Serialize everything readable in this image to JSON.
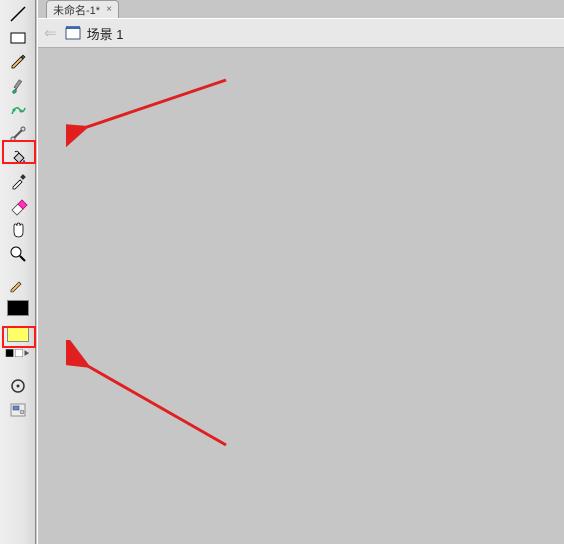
{
  "tab": {
    "label": "未命名-1*",
    "close_glyph": "×"
  },
  "scene": {
    "back_glyph": "⇐",
    "label": "场景 1"
  },
  "tools": [
    {
      "id": "line",
      "name": "line-tool-icon"
    },
    {
      "id": "rectangle",
      "name": "rectangle-tool-icon"
    },
    {
      "id": "pencil",
      "name": "pencil-tool-icon"
    },
    {
      "id": "brush",
      "name": "brush-tool-icon"
    },
    {
      "id": "deco",
      "name": "deco-tool-icon"
    },
    {
      "id": "bone",
      "name": "bone-tool-icon"
    },
    {
      "id": "paintbucket",
      "name": "paint-bucket-tool-icon",
      "highlight": true
    },
    {
      "id": "eyedropper",
      "name": "eyedropper-tool-icon"
    },
    {
      "id": "eraser",
      "name": "eraser-tool-icon"
    },
    {
      "id": "hand",
      "name": "hand-tool-icon"
    },
    {
      "id": "zoom",
      "name": "zoom-tool-icon"
    }
  ],
  "colors": {
    "stroke_swatch": "#000000",
    "fill_swatch": "#ffff66",
    "fill_highlight": true
  },
  "color_mode_icons": [
    "swap-colors-icon",
    "no-color-icon"
  ],
  "below_tools": [
    {
      "id": "snap",
      "name": "snap-tool-icon"
    },
    {
      "id": "options",
      "name": "options-tool-icon"
    }
  ],
  "annotations": {
    "arrow_color": "#e02020"
  }
}
